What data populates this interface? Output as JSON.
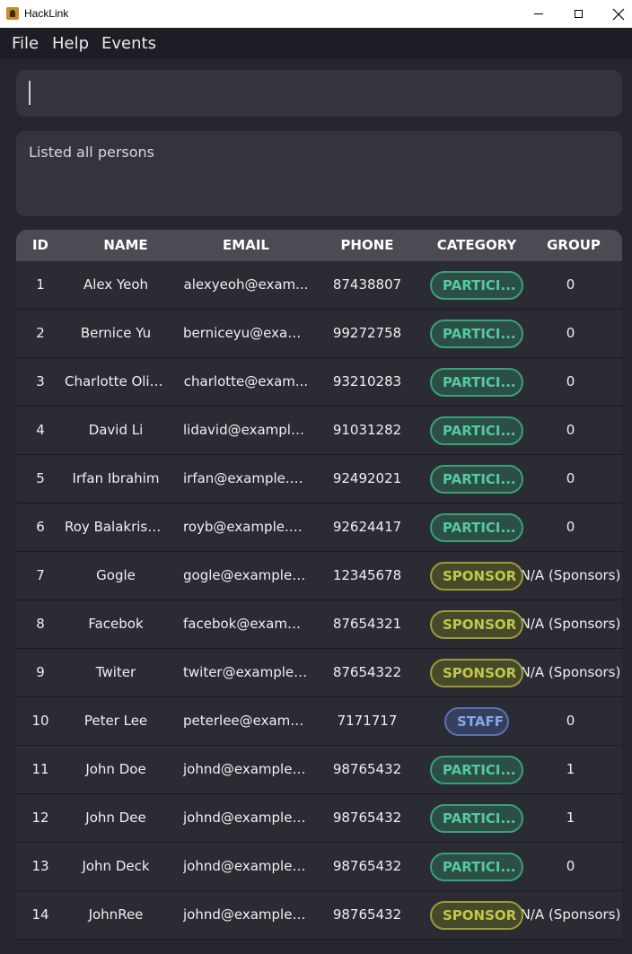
{
  "window": {
    "title": "HackLink"
  },
  "menu": [
    "File",
    "Help",
    "Events"
  ],
  "command": {
    "value": "",
    "placeholder": ""
  },
  "result": {
    "text": "Listed all persons"
  },
  "table": {
    "headers": [
      "ID",
      "NAME",
      "EMAIL",
      "PHONE",
      "CATEGORY",
      "GROUP"
    ],
    "rows": [
      {
        "id": "1",
        "name": "Alex Yeoh",
        "email": "alexyeoh@exam...",
        "phone": "87438807",
        "category": "PARTICI...",
        "cat_type": "participant",
        "group": "0"
      },
      {
        "id": "2",
        "name": "Bernice Yu",
        "email": "berniceyu@exam...",
        "phone": "99272758",
        "category": "PARTICI...",
        "cat_type": "participant",
        "group": "0"
      },
      {
        "id": "3",
        "name": "Charlotte Oliv...",
        "email": "charlotte@exam...",
        "phone": "93210283",
        "category": "PARTICI...",
        "cat_type": "participant",
        "group": "0"
      },
      {
        "id": "4",
        "name": "David Li",
        "email": "lidavid@example...",
        "phone": "91031282",
        "category": "PARTICI...",
        "cat_type": "participant",
        "group": "0"
      },
      {
        "id": "5",
        "name": "Irfan Ibrahim",
        "email": "irfan@example.c...",
        "phone": "92492021",
        "category": "PARTICI...",
        "cat_type": "participant",
        "group": "0"
      },
      {
        "id": "6",
        "name": "Roy Balakrish...",
        "email": "royb@example.c...",
        "phone": "92624417",
        "category": "PARTICI...",
        "cat_type": "participant",
        "group": "0"
      },
      {
        "id": "7",
        "name": "Gogle",
        "email": "gogle@example....",
        "phone": "12345678",
        "category": "SPONSOR",
        "cat_type": "sponsor",
        "group": "N/A (Sponsors)"
      },
      {
        "id": "8",
        "name": "Facebok",
        "email": "facebok@exampl...",
        "phone": "87654321",
        "category": "SPONSOR",
        "cat_type": "sponsor",
        "group": "N/A (Sponsors)"
      },
      {
        "id": "9",
        "name": "Twiter",
        "email": "twiter@example....",
        "phone": "87654322",
        "category": "SPONSOR",
        "cat_type": "sponsor",
        "group": "N/A (Sponsors)"
      },
      {
        "id": "10",
        "name": "Peter Lee",
        "email": "peterlee@examp...",
        "phone": "7171717",
        "category": "STAFF",
        "cat_type": "staff",
        "group": "0"
      },
      {
        "id": "11",
        "name": "John Doe",
        "email": "johnd@example....",
        "phone": "98765432",
        "category": "PARTICI...",
        "cat_type": "participant",
        "group": "1"
      },
      {
        "id": "12",
        "name": "John Dee",
        "email": "johnd@example....",
        "phone": "98765432",
        "category": "PARTICI...",
        "cat_type": "participant",
        "group": "1"
      },
      {
        "id": "13",
        "name": "John Deck",
        "email": "johnd@example....",
        "phone": "98765432",
        "category": "PARTICI...",
        "cat_type": "participant",
        "group": "0"
      },
      {
        "id": "14",
        "name": "JohnRee",
        "email": "johnd@example....",
        "phone": "98765432",
        "category": "SPONSOR",
        "cat_type": "sponsor",
        "group": "N/A (Sponsors)"
      }
    ]
  },
  "colors": {
    "background": "#25262e",
    "participant": "#55c9a0",
    "sponsor": "#c4c64a",
    "staff": "#8aa6e8"
  }
}
